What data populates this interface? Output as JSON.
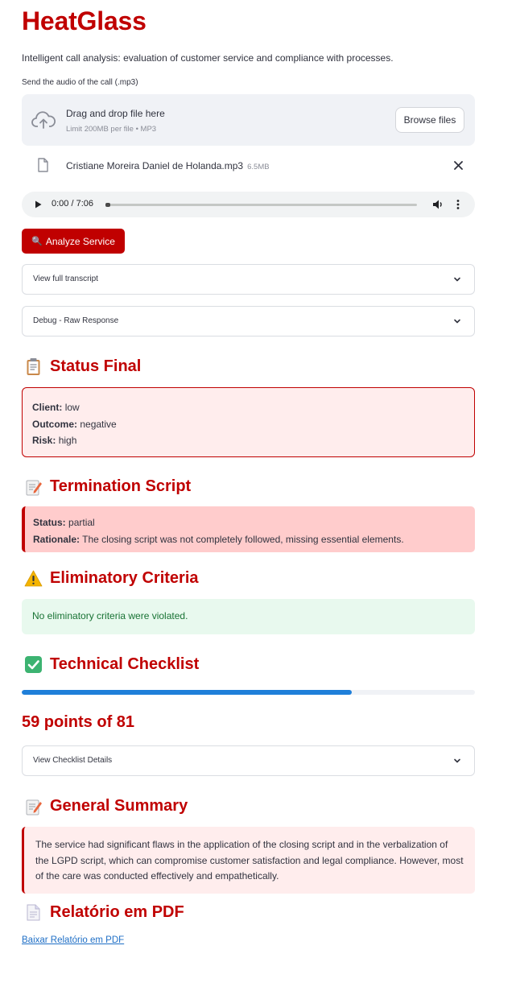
{
  "app": {
    "title": "HeatGlass",
    "description": "Intelligent call analysis: evaluation of customer service and compliance with processes."
  },
  "upload": {
    "label": "Send the audio of the call (.mp3)",
    "drop_text": "Drag and drop file here",
    "limit_text": "Limit 200MB per file • MP3",
    "browse_label": "Browse files",
    "file_name": "Cristiane Moreira Daniel de Holanda.mp3",
    "file_size": "6.5MB"
  },
  "audio": {
    "time": "0:00 / 7:06",
    "progress": 0.0
  },
  "analyze_button": {
    "icon": "🔍",
    "label": "Analyze Service"
  },
  "expanders": {
    "transcript": "View full transcript",
    "debug": "Debug - Raw Response",
    "checklist": "View Checklist Details"
  },
  "status_final": {
    "heading": "Status Final",
    "icon": "📋",
    "client_label": "Client:",
    "client_value": "low",
    "outcome_label": "Outcome:",
    "outcome_value": "negative",
    "risk_label": "Risk:",
    "risk_value": "high"
  },
  "termination": {
    "heading": "Termination Script",
    "icon": "📝",
    "status_label": "Status:",
    "status_value": "partial",
    "rationale_label": "Rationale:",
    "rationale_value": "The closing script was not completely followed, missing essential elements."
  },
  "eliminatory": {
    "heading": "Eliminatory Criteria",
    "icon": "⚠️",
    "message": "No eliminatory criteria were violated."
  },
  "technical": {
    "heading": "Technical Checklist",
    "icon": "✅",
    "points": 59,
    "total": 81,
    "points_text": "59 points of 81"
  },
  "summary": {
    "heading": "General Summary",
    "icon": "📝",
    "text": "The service had significant flaws in the application of the closing script and in the verbalization of the LGPD script, which can compromise customer satisfaction and legal compliance. However, most of the care was conducted effectively and empathetically."
  },
  "pdf": {
    "heading": "Relatório em PDF",
    "icon": "📄",
    "link_text": "Baixar Relatório em PDF"
  },
  "colors": {
    "brand_red": "#c00000",
    "progress_blue": "#1f7fd9",
    "success_green": "#177233"
  }
}
